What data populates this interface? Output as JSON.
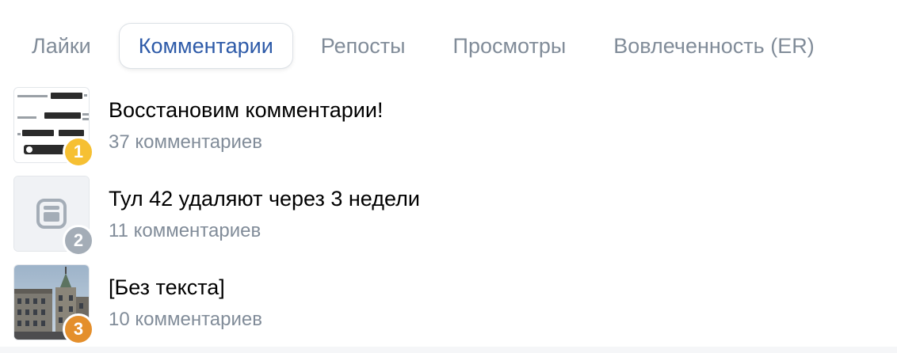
{
  "tabs": [
    {
      "label": "Лайки",
      "active": false
    },
    {
      "label": "Комментарии",
      "active": true
    },
    {
      "label": "Репосты",
      "active": false
    },
    {
      "label": "Просмотры",
      "active": false
    },
    {
      "label": "Вовлеченность (ER)",
      "active": false
    }
  ],
  "posts": [
    {
      "rank": "1",
      "title": "Восстановим комментарии!",
      "count": "37 комментариев",
      "thumbnail": "screenshot-thumbnail",
      "rank_color": "#f6c033"
    },
    {
      "rank": "2",
      "title": "Тул 42 удаляют через 3 недели",
      "count": "11 комментариев",
      "thumbnail": "post-placeholder-icon",
      "rank_color": "#a4adb7"
    },
    {
      "rank": "3",
      "title": "[Без текста]",
      "count": "10 комментариев",
      "thumbnail": "building-photo-thumbnail",
      "rank_color": "#e48f2c"
    }
  ],
  "colors": {
    "active_tab_text": "#2d5aa8",
    "inactive_tab_text": "#818c99",
    "secondary_text": "#818c99"
  }
}
